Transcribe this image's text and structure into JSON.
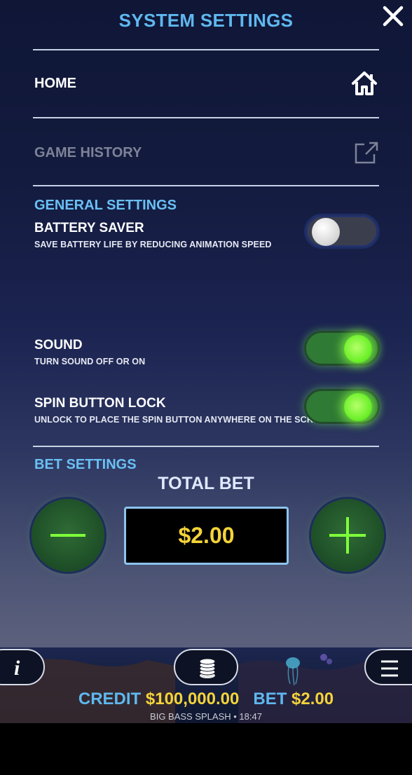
{
  "header": {
    "title": "SYSTEM SETTINGS",
    "close_icon": "close-icon"
  },
  "menu": {
    "home_label": "HOME",
    "home_icon": "home-icon",
    "history_label": "GAME HISTORY",
    "history_icon": "external-link-icon"
  },
  "general": {
    "heading": "GENERAL SETTINGS",
    "battery_saver": {
      "title": "BATTERY SAVER",
      "desc": "SAVE BATTERY LIFE BY REDUCING ANIMATION SPEED",
      "on": false
    },
    "sound": {
      "title": "SOUND",
      "desc": "TURN SOUND OFF OR ON",
      "on": true
    },
    "spin_lock": {
      "title": "SPIN BUTTON LOCK",
      "desc": "UNLOCK TO PLACE THE SPIN BUTTON ANYWHERE ON THE SCREEN",
      "on": true
    }
  },
  "bet": {
    "heading": "BET SETTINGS",
    "total_label": "TOTAL BET",
    "value": "$2.00"
  },
  "footer": {
    "credit_label": "CREDIT",
    "credit_value": "$100,000.00",
    "bet_label": "BET",
    "bet_value": "$2.00",
    "game_info": "BIG BASS SPLASH • 18:47",
    "info_symbol": "i"
  },
  "colors": {
    "accent_blue": "#5fb8ef",
    "value_yellow": "#f4d33a",
    "toggle_on_green": "#6ff12c"
  }
}
